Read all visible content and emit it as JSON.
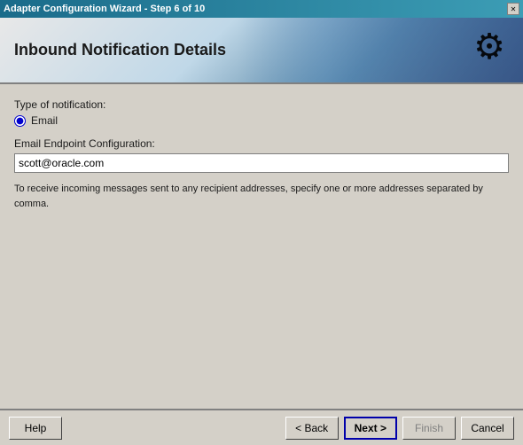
{
  "titlebar": {
    "text": "Adapter Configuration Wizard - Step 6 of 10",
    "close_btn": "✕"
  },
  "header": {
    "title": "Inbound Notification Details",
    "icon": "⚙"
  },
  "form": {
    "notification_type_label": "Type of notification:",
    "radio_option": "Email",
    "endpoint_label": "Email Endpoint Configuration:",
    "endpoint_value": "scott@oracle.com",
    "hint_text": "To receive incoming messages sent to any recipient addresses, specify one or more addresses separated by comma."
  },
  "footer": {
    "help_label": "Help",
    "back_label": "< Back",
    "next_label": "Next >",
    "finish_label": "Finish",
    "cancel_label": "Cancel"
  }
}
